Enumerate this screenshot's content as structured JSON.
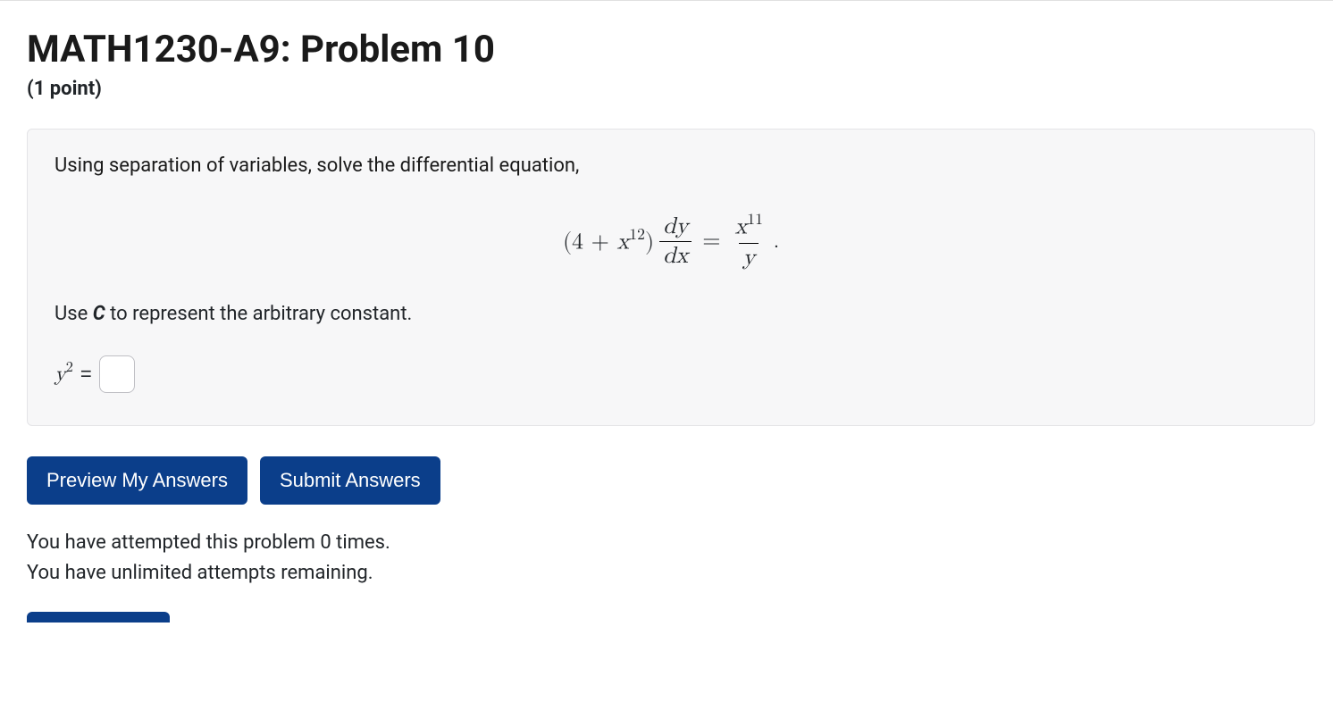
{
  "header": {
    "title": "MATH1230-A9: Problem 10",
    "points": "(1 point)"
  },
  "problem": {
    "prompt": "Using separation of variables, solve the differential equation,",
    "equation": {
      "left_coef_open": "(4 + ",
      "left_var": "x",
      "left_exp": "12",
      "left_coef_close": ")",
      "frac1_num_d": "d",
      "frac1_num_y": "y",
      "frac1_den_d": "d",
      "frac1_den_x": "x",
      "equals": "=",
      "frac2_num_var": "x",
      "frac2_num_exp": "11",
      "frac2_den_var": "y",
      "period": "."
    },
    "hint_pre": "Use ",
    "hint_bold": "C",
    "hint_post": " to represent the arbitrary constant.",
    "answer_lhs_var": "y",
    "answer_lhs_exp": "2",
    "answer_equals": "="
  },
  "buttons": {
    "preview": "Preview My Answers",
    "submit": "Submit Answers"
  },
  "attempts": {
    "line1": "You have attempted this problem 0 times.",
    "line2": "You have unlimited attempts remaining."
  }
}
